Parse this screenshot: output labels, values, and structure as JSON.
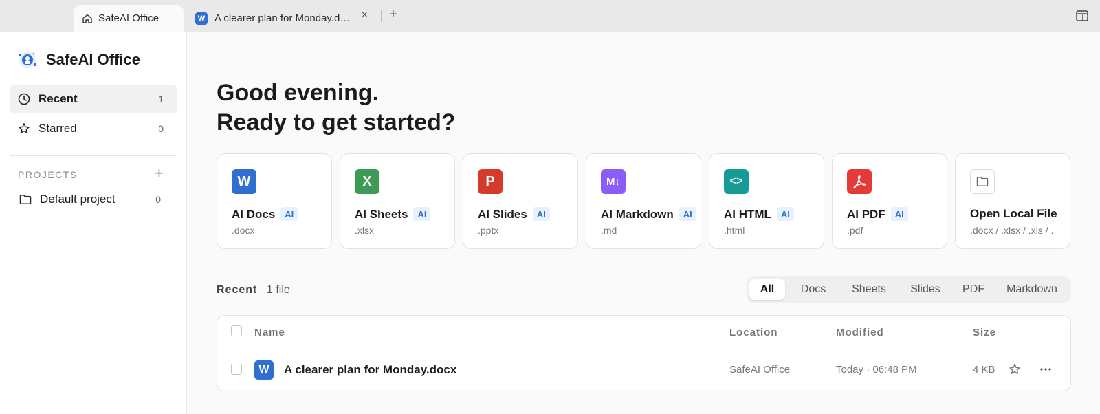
{
  "tabs": {
    "home": {
      "label": "SafeAI Office"
    },
    "doc": {
      "label": "A clearer plan for Monday.docx",
      "icon_letter": "W",
      "close": "×"
    },
    "add": "+"
  },
  "sidebar": {
    "brand": "SafeAI Office",
    "nav": [
      {
        "label": "Recent",
        "count": "1",
        "icon": "clock-icon",
        "active": true
      },
      {
        "label": "Starred",
        "count": "0",
        "icon": "star-icon",
        "active": false
      }
    ],
    "projects_label": "PROJECTS",
    "projects_add": "+",
    "projects": [
      {
        "label": "Default project",
        "count": "0",
        "icon": "folder-icon"
      }
    ]
  },
  "main": {
    "greeting_line1": "Good evening.",
    "greeting_line2": "Ready to get started?",
    "cards": [
      {
        "name": "AI Docs",
        "badge": "AI",
        "ext": ".docx",
        "icon_letter": "W",
        "color": "#2f6fd0"
      },
      {
        "name": "AI Sheets",
        "badge": "AI",
        "ext": ".xlsx",
        "icon_letter": "X",
        "color": "#3f9a57"
      },
      {
        "name": "AI Slides",
        "badge": "AI",
        "ext": ".pptx",
        "icon_letter": "P",
        "color": "#d43b2a"
      },
      {
        "name": "AI Markdown",
        "badge": "AI",
        "ext": ".md",
        "icon_letter": "M↓",
        "color": "#8b5cf6"
      },
      {
        "name": "AI HTML",
        "badge": "AI",
        "ext": ".html",
        "icon_letter": "<>",
        "color": "#169c96"
      },
      {
        "name": "AI PDF",
        "badge": "AI",
        "ext": ".pdf",
        "icon_letter": "pdf",
        "color": "#e5393a"
      },
      {
        "name": "Open Local File",
        "badge": "",
        "ext": ".docx / .xlsx / .xls / .",
        "icon_letter": "",
        "color": "#ffffff"
      }
    ],
    "recent_label": "Recent",
    "recent_count": "1 file",
    "filters": [
      "All",
      "Docs",
      "Sheets",
      "Slides",
      "PDF",
      "Markdown"
    ],
    "filter_active": "All",
    "table": {
      "headers": {
        "name": "Name",
        "location": "Location",
        "modified": "Modified",
        "size": "Size"
      },
      "rows": [
        {
          "name": "A clearer plan for Monday.docx",
          "location": "SafeAI Office",
          "modified": "Today · 06:48 PM",
          "size": "4 KB",
          "icon_letter": "W"
        }
      ]
    }
  }
}
